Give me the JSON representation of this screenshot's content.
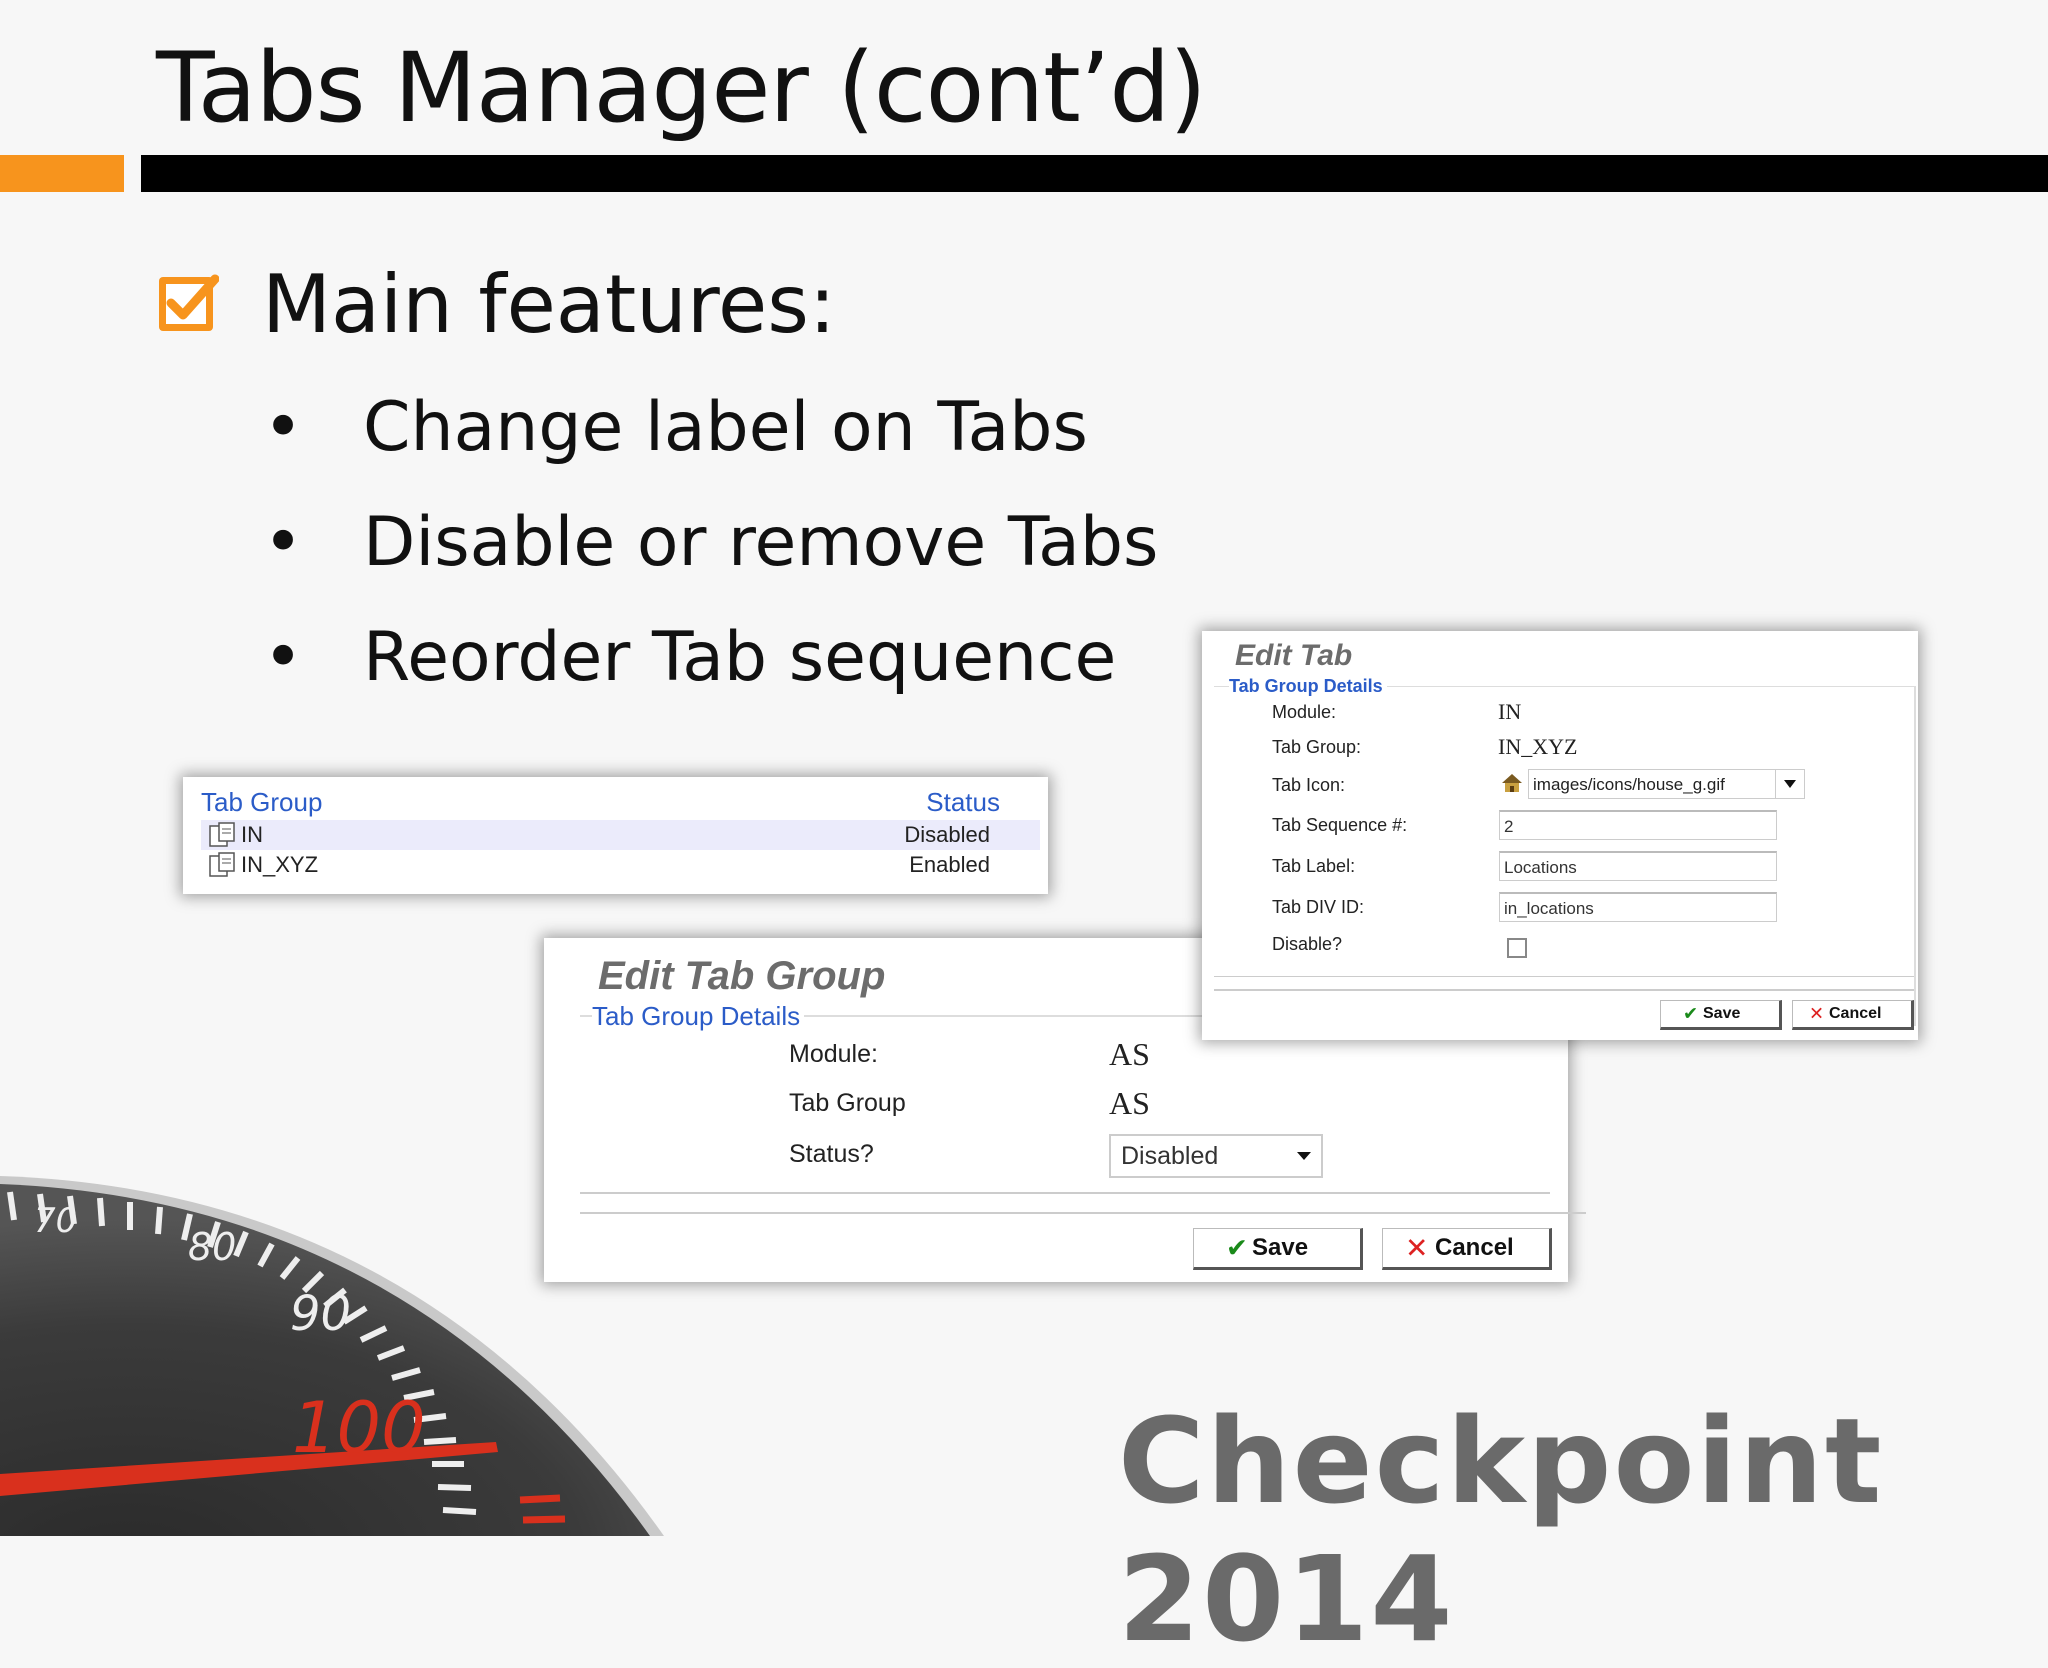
{
  "slide": {
    "title": "Tabs Manager (cont’d)",
    "heading": "Main features:",
    "bullets": [
      "Change label on Tabs",
      "Disable or remove Tabs",
      "Reorder Tab sequence"
    ],
    "brand": "Checkpoint 2014",
    "accent_color": "#f7941d"
  },
  "tab_group_list": {
    "header_left": "Tab Group",
    "header_right": "Status",
    "rows": [
      {
        "name": "IN",
        "status": "Disabled"
      },
      {
        "name": "IN_XYZ",
        "status": "Enabled"
      }
    ]
  },
  "edit_tab_group": {
    "title": "Edit Tab Group",
    "legend": "Tab Group Details",
    "module_label": "Module:",
    "module_value": "AS",
    "tab_group_label": "Tab Group",
    "tab_group_value": "AS",
    "status_label": "Status?",
    "status_value": "Disabled",
    "save_label": "Save",
    "cancel_label": "Cancel"
  },
  "edit_tab": {
    "title": "Edit Tab",
    "legend": "Tab Group Details",
    "module_label": "Module:",
    "module_value": "IN",
    "tab_group_label": "Tab Group:",
    "tab_group_value": "IN_XYZ",
    "tab_icon_label": "Tab Icon:",
    "tab_icon_value": "images/icons/house_g.gif",
    "sequence_label": "Tab Sequence #:",
    "sequence_value": "2",
    "tab_label_label": "Tab Label:",
    "tab_label_value": "Locations",
    "div_id_label": "Tab DIV ID:",
    "div_id_value": "in_locations",
    "disable_label": "Disable?",
    "save_label": "Save",
    "cancel_label": "Cancel"
  },
  "speedometer": {
    "numbers": [
      "70",
      "80",
      "90",
      "100"
    ]
  }
}
